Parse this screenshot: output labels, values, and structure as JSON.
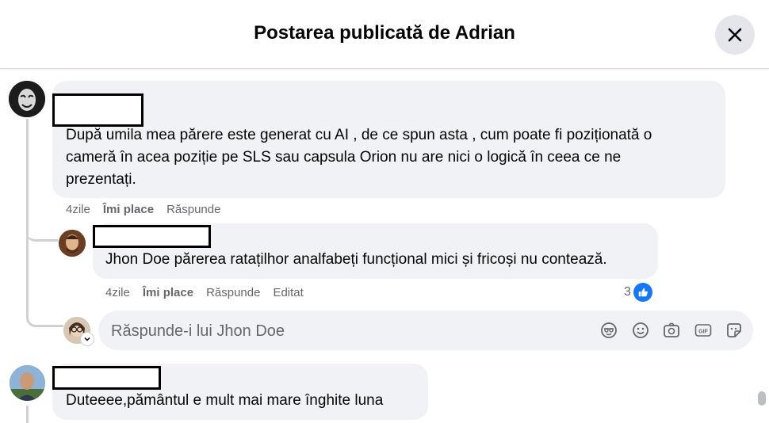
{
  "header": {
    "title": "Postarea publicată de Adrian"
  },
  "comments": [
    {
      "text_line1": "După umila mea părere este generat cu AI , de ce spun asta , cum poate fi poziționată o",
      "text_line2": "cameră în acea poziție pe SLS sau capsula Orion nu are nici o logică în ceea ce ne",
      "text_line3": "prezentați.",
      "time": "4zile",
      "like": "Îmi place",
      "reply": "Răspunde"
    },
    {
      "text": "Jhon Doe părerea ratațilhor analfabeți funcțional mici și fricoși nu contează.",
      "time": "4zile",
      "like": "Îmi place",
      "reply": "Răspunde",
      "edited": "Editat",
      "reaction_count": "3"
    },
    {
      "text": "Duteeee,pământul e mult mai mare înghite luna"
    }
  ],
  "reply_box": {
    "placeholder": "Răspunde-i lui Jhon Doe"
  },
  "colors": {
    "accent": "#1877f2",
    "bubble": "#f0f2f5",
    "muted": "#65676b"
  }
}
